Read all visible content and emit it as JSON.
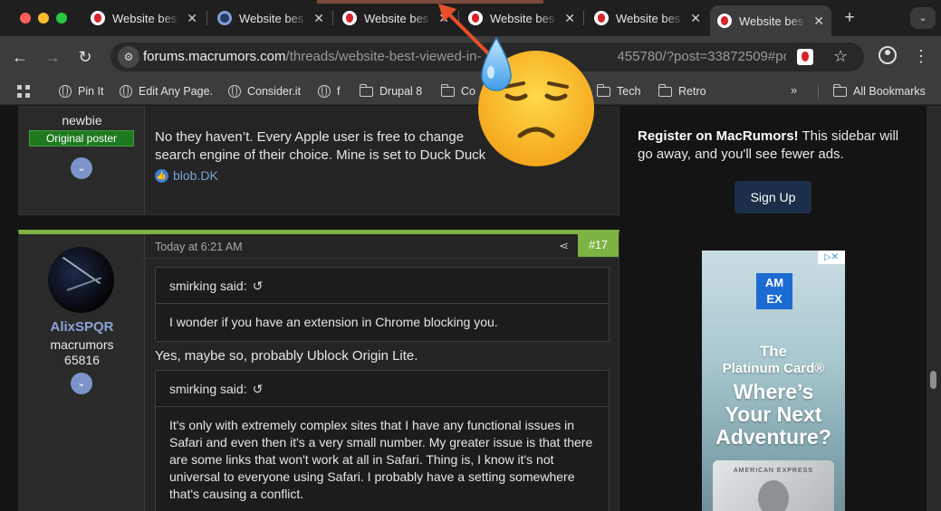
{
  "tabs": [
    {
      "title": "Website bes",
      "icon": "macrumors-favicon",
      "active": false
    },
    {
      "title": "Website bes",
      "icon": "edge-favicon",
      "active": false
    },
    {
      "title": "Website bes",
      "icon": "macrumors-favicon",
      "active": false
    },
    {
      "title": "Website bes",
      "icon": "macrumors-favicon",
      "active": false
    },
    {
      "title": "Website bes",
      "icon": "macrumors-favicon",
      "active": false
    },
    {
      "title": "Website bes",
      "icon": "macrumors-favicon",
      "active": true
    }
  ],
  "tab_close_glyph": "✕",
  "new_tab_glyph": "+",
  "tab_menu_glyph": "⌄",
  "address_bar": {
    "host": "forums.macrumors.com",
    "path": "/threads/website-best-viewed-in-",
    "path_tail": "455780/?post=33872509#post-33..."
  },
  "bookmarks": [
    {
      "label": "Pin It",
      "icon": "globe-icon"
    },
    {
      "label": "Edit Any Page.",
      "icon": "globe-icon"
    },
    {
      "label": "Consider.it",
      "icon": "globe-icon"
    },
    {
      "label": "f",
      "icon": "globe-icon"
    },
    {
      "label": "Drupal 8",
      "icon": "folder-icon"
    },
    {
      "label": "Co",
      "icon": "folder-icon"
    },
    {
      "label": "Tech",
      "icon": "folder-icon"
    },
    {
      "label": "Retro",
      "icon": "folder-icon"
    }
  ],
  "bookmarks_more": "»",
  "all_bookmarks": "All Bookmarks",
  "post1": {
    "user_title": "newbie",
    "badge": "Original poster",
    "text_line1": "No they haven’t. Every Apple user is free to change",
    "text_line2": "search engine of their choice. Mine is set to Duck Duck",
    "reaction_user": "blob.DK"
  },
  "post2": {
    "date": "Today at 6:21 AM",
    "number": "#17",
    "username": "AlixSPQR",
    "user_title": "macrumors",
    "user_title2": "65816",
    "quote1_author": "smirking said:",
    "quote1_text": "I wonder if you have an extension in Chrome blocking you.",
    "reply_text": "Yes, maybe so, probably Ublock Origin Lite.",
    "quote2_author": "smirking said:",
    "quote2_text": "It's only with extremely complex sites that I have any functional issues in Safari and even then it's a very small number. My greater issue is that there are some links that won't work at all in Safari. Thing is, I know it's not universal to everyone using Safari. I probably have a setting somewhere that's causing a conflict."
  },
  "sidebar": {
    "register_bold": "Register on MacRumors!",
    "register_text": " This sidebar will go away, and you'll see fewer ads.",
    "signup_label": "Sign Up"
  },
  "ad": {
    "logo_line1": "AM",
    "logo_line2": "EX",
    "line1": "The",
    "line2": "Platinum Card®",
    "line3": "Where’s",
    "line4": "Your Next",
    "line5": "Adventure?",
    "card_text": "AMERICAN EXPRESS",
    "choices": "▷✕"
  },
  "overlay": {
    "emoji": "anxious-face-with-sweat",
    "arrow_color": "#e8502a"
  }
}
